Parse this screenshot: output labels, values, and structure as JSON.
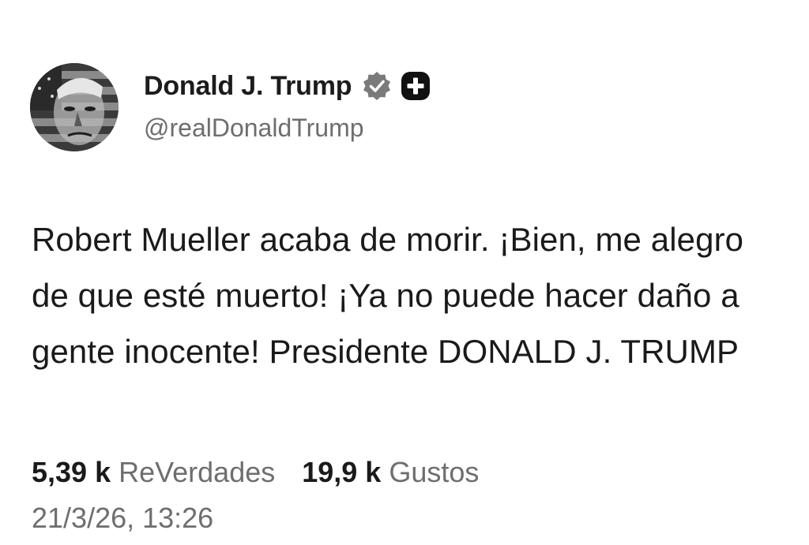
{
  "author": {
    "display_name": "Donald J. Trump",
    "handle": "@realDonaldTrump",
    "avatar_icon": "profile-portrait-flag-avatar",
    "verified_icon": "verified-badge-icon",
    "extra_icon": "plus-badge-icon"
  },
  "post": {
    "text": "Robert Mueller acaba de morir. ¡Bien, me alegro de que esté muerto! ¡Ya no puede hacer daño a gente inocente! Presidente DONALD J. TRUMP"
  },
  "stats": {
    "reposts_count": "5,39 k",
    "reposts_label": "ReVerdades",
    "likes_count": "19,9 k",
    "likes_label": "Gustos"
  },
  "timestamp": "21/3/26, 13:26",
  "colors": {
    "text_primary": "#1a1a1a",
    "text_secondary": "#6e6e6e",
    "background": "#ffffff"
  }
}
